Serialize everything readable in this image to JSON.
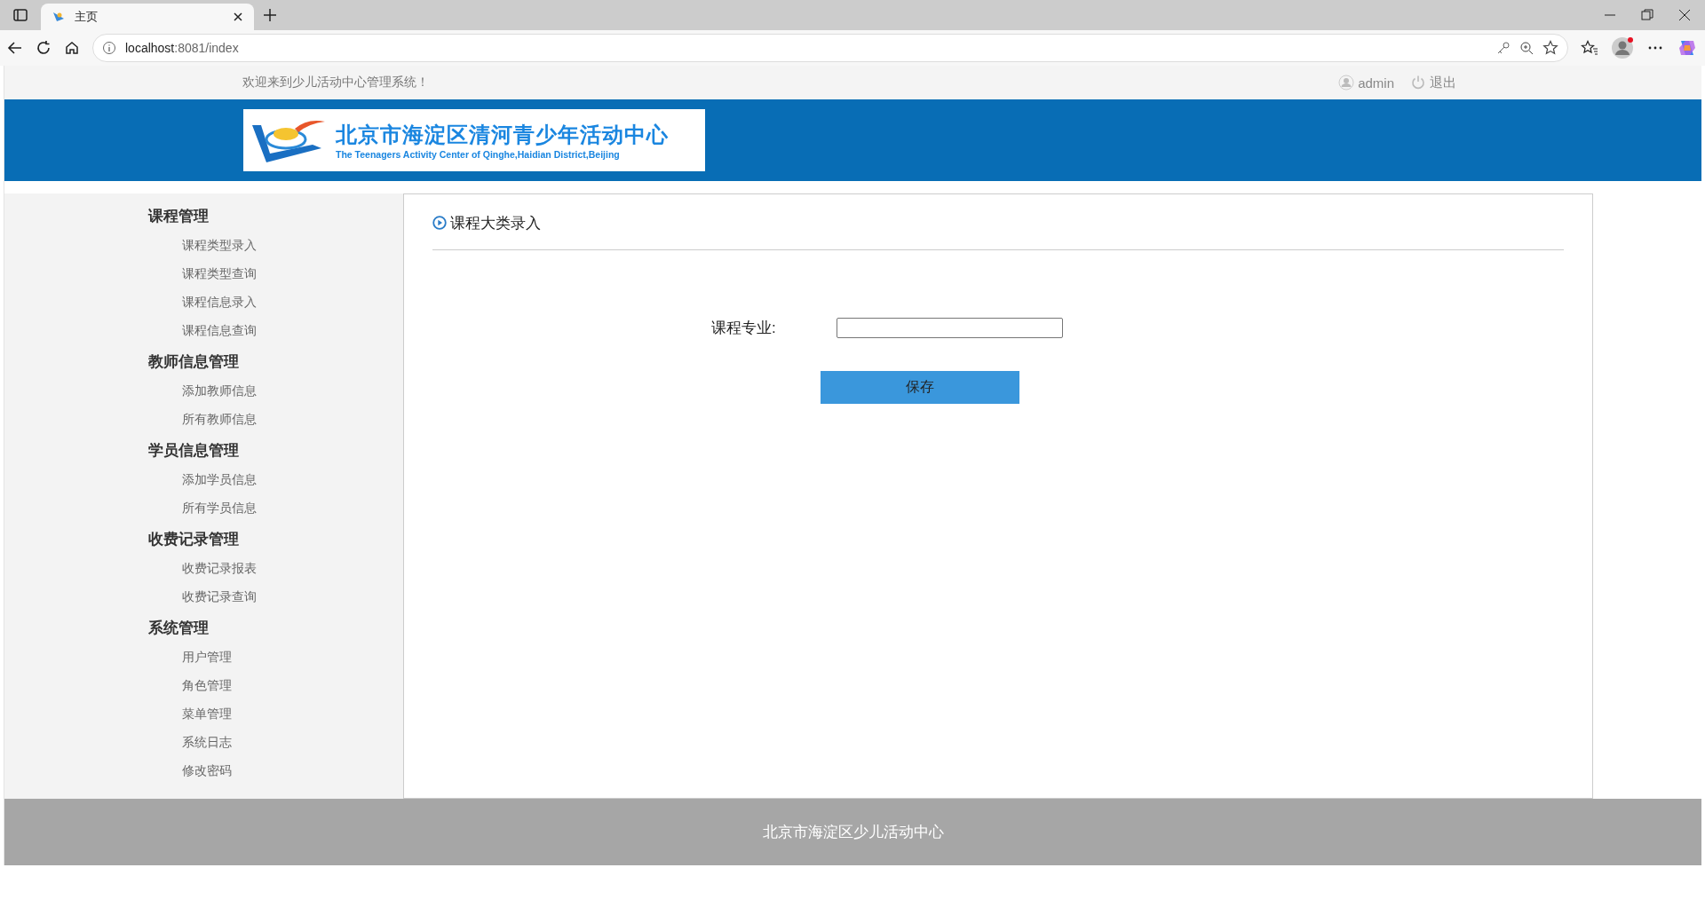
{
  "browser": {
    "tab_title": "主页",
    "url_host": "localhost",
    "url_path": ":8081/index"
  },
  "top_bar": {
    "welcome": "欢迎来到少儿活动中心管理系统！",
    "user": "admin",
    "logout": "退出"
  },
  "header": {
    "logo_title": "北京市海淀区清河青少年活动中心",
    "logo_subtitle": "The Teenagers Activity Center of Qinghe,Haidian District,Beijing"
  },
  "sidebar": {
    "sections": [
      {
        "title": "课程管理",
        "items": [
          "课程类型录入",
          "课程类型查询",
          "课程信息录入",
          "课程信息查询"
        ]
      },
      {
        "title": "教师信息管理",
        "items": [
          "添加教师信息",
          "所有教师信息"
        ]
      },
      {
        "title": "学员信息管理",
        "items": [
          "添加学员信息",
          "所有学员信息"
        ]
      },
      {
        "title": "收费记录管理",
        "items": [
          "收费记录报表",
          "收费记录查询"
        ]
      },
      {
        "title": "系统管理",
        "items": [
          "用户管理",
          "角色管理",
          "菜单管理",
          "系统日志",
          "修改密码"
        ]
      }
    ]
  },
  "content": {
    "title": "课程大类录入",
    "form": {
      "label": "课程专业:",
      "save_button": "保存"
    }
  },
  "footer": {
    "text": "北京市海淀区少儿活动中心"
  }
}
